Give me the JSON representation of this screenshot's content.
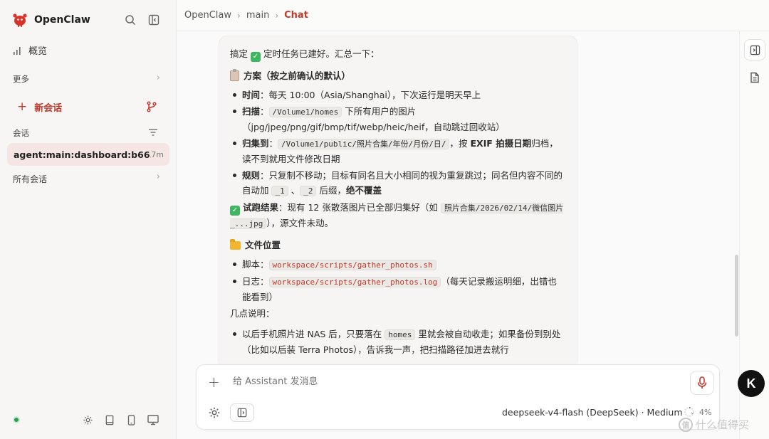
{
  "sidebar": {
    "brand": "OpenClaw",
    "overview": "概览",
    "more": "更多",
    "new_chat": "新会话",
    "sessions_label": "会话",
    "active_session": {
      "title": "agent:main:dashboard:b66...",
      "time": "7m"
    },
    "all_sessions": "所有会话"
  },
  "breadcrumb": {
    "root": "OpenClaw",
    "branch": "main",
    "current": "Chat"
  },
  "message": {
    "intro_pre": "搞定",
    "intro_post": "定时任务已建好。汇总一下：",
    "plan_heading": "方案（按之前确认的默认）",
    "time_label": "时间",
    "time_text": "：每天 10:00（Asia/Shanghai），下次运行是明天早上",
    "scan_label": "扫描",
    "scan_colon": "：",
    "scan_code": "/Volume1/homes",
    "scan_text": " 下所有用户的图片（jpg/jpeg/png/gif/bmp/tif/webp/heic/heif，自动跳过回收站）",
    "archive_label": "归集到",
    "archive_colon": "：",
    "archive_code": "/Volume1/public/照片合集/年份/月份/日/",
    "archive_text1": "，按 ",
    "archive_bold": "EXIF 拍摄日期",
    "archive_text2": "归档，读不到就用文件修改日期",
    "rule_label": "规则",
    "rule_text": "：只复制不移动；目标有同名且大小相同的视为重复跳过；同名但内容不同的自动加 ",
    "rule_code1": "_1",
    "rule_sep": " 、",
    "rule_code2": "_2",
    "rule_text2": " 后缀，",
    "rule_bold": "绝不覆盖",
    "trial_label": "试跑结果",
    "trial_text": "：现有 12 张散落图片已全部归集好（如 ",
    "trial_code": "照片合集/2026/02/14/微信图片_...jpg",
    "trial_text2": "），源文件未动。",
    "files_heading": "文件位置",
    "script_label": "脚本：",
    "script_code": "workspace/scripts/gather_photos.sh",
    "log_label": "日志：",
    "log_code": "workspace/scripts/gather_photos.log",
    "log_text": "（每天记录搬运明细，出错也能看到）",
    "notes_heading": "几点说明：",
    "note1_text1": "以后手机照片进 NAS 后，只要落在 ",
    "note1_code": "homes",
    "note1_text2": " 里就会被自动收走；如果备份到别处（比如以后装 Terra Photos），告诉我一声，把扫描路径加进去就行"
  },
  "composer": {
    "placeholder": "给 Assistant 发消息",
    "model": "deepseek-v4-flash (DeepSeek) · Medium",
    "context_pct": "4%"
  },
  "overlay": {
    "badge_letter": "K",
    "watermark_logo": "值",
    "watermark": "什么值得买"
  },
  "colors": {
    "accent": "#c0392b",
    "active_session_bg": "#f5e6e4",
    "status_ok": "#2e9e4f"
  }
}
